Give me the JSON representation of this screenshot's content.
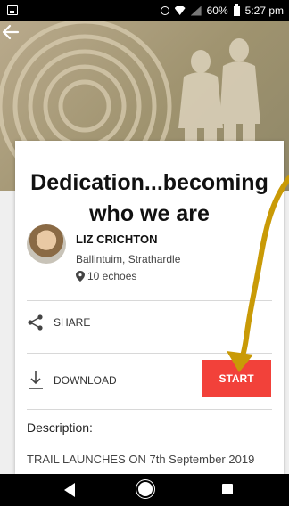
{
  "status_bar": {
    "battery_percent": "60%",
    "time": "5:27 pm",
    "icons": [
      "image-icon",
      "alarm-icon",
      "wifi-icon",
      "signal-icon",
      "battery-icon"
    ]
  },
  "header": {
    "back_icon": "back-arrow-icon"
  },
  "trail": {
    "title": "Dedication...becoming who we are",
    "author": "LIZ CRICHTON",
    "location": "Ballintuim, Strathardle",
    "echoes": "10 echoes"
  },
  "actions": {
    "share_label": "SHARE",
    "download_label": "DOWNLOAD",
    "start_label": "START"
  },
  "description": {
    "label": "Description:",
    "text": "TRAIL LAUNCHES ON 7th September 2019"
  },
  "colors": {
    "accent": "#f2413a",
    "annotation_arrow": "#c99a06"
  }
}
